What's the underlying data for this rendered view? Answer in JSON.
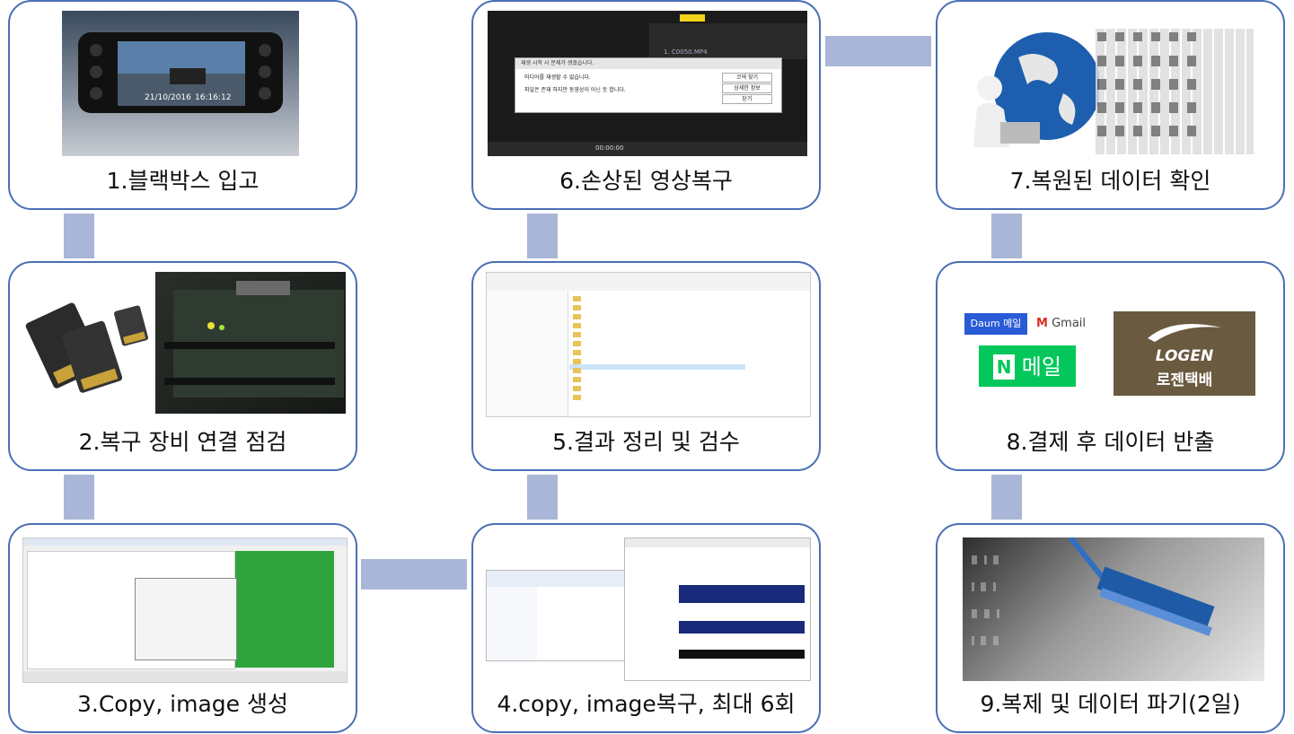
{
  "steps": [
    {
      "num": "1",
      "label": "1.블랙박스 입고"
    },
    {
      "num": "2",
      "label": "2.복구 장비 연결 점검"
    },
    {
      "num": "3",
      "label": "3.Copy, image 생성"
    },
    {
      "num": "4",
      "label": "4.copy, image복구, 최대 6회"
    },
    {
      "num": "5",
      "label": "5.결과 정리 및 검수"
    },
    {
      "num": "6",
      "label": "6.손상된 영상복구"
    },
    {
      "num": "7",
      "label": "7.복원된 데이터 확인"
    },
    {
      "num": "8",
      "label": "8.결제 후 데이터 반출"
    },
    {
      "num": "9",
      "label": "9.복제 및 데이터 파기(2일)"
    }
  ],
  "dashcam": {
    "date": "21/10/2016",
    "time": "16:16:12"
  },
  "player_error": {
    "title": "재생 시작 시 문제가 생겼습니다.",
    "line1": "미디어를 재생할 수 없습니다.",
    "line2": "파일은 존재 하지만 동영상이 아닌 듯 합니다.",
    "btn_find": "코덱 찾기",
    "btn_detail": "상세한 정보",
    "btn_close": "닫기",
    "file": "1. C0050.MP4",
    "time": "00:00:00"
  },
  "logos": {
    "daum": "Daum 메일",
    "gmail": "Gmail",
    "naver_n": "N",
    "naver": "메일",
    "logen_en": "LOGEN",
    "logen_ko": "로젠택배"
  },
  "colors": {
    "border": "#4a6fb5",
    "connector": "#aab6d8",
    "naver_green": "#03c75a",
    "daum_blue": "#2a5bd7",
    "logen_brown": "#6a5a3f"
  }
}
